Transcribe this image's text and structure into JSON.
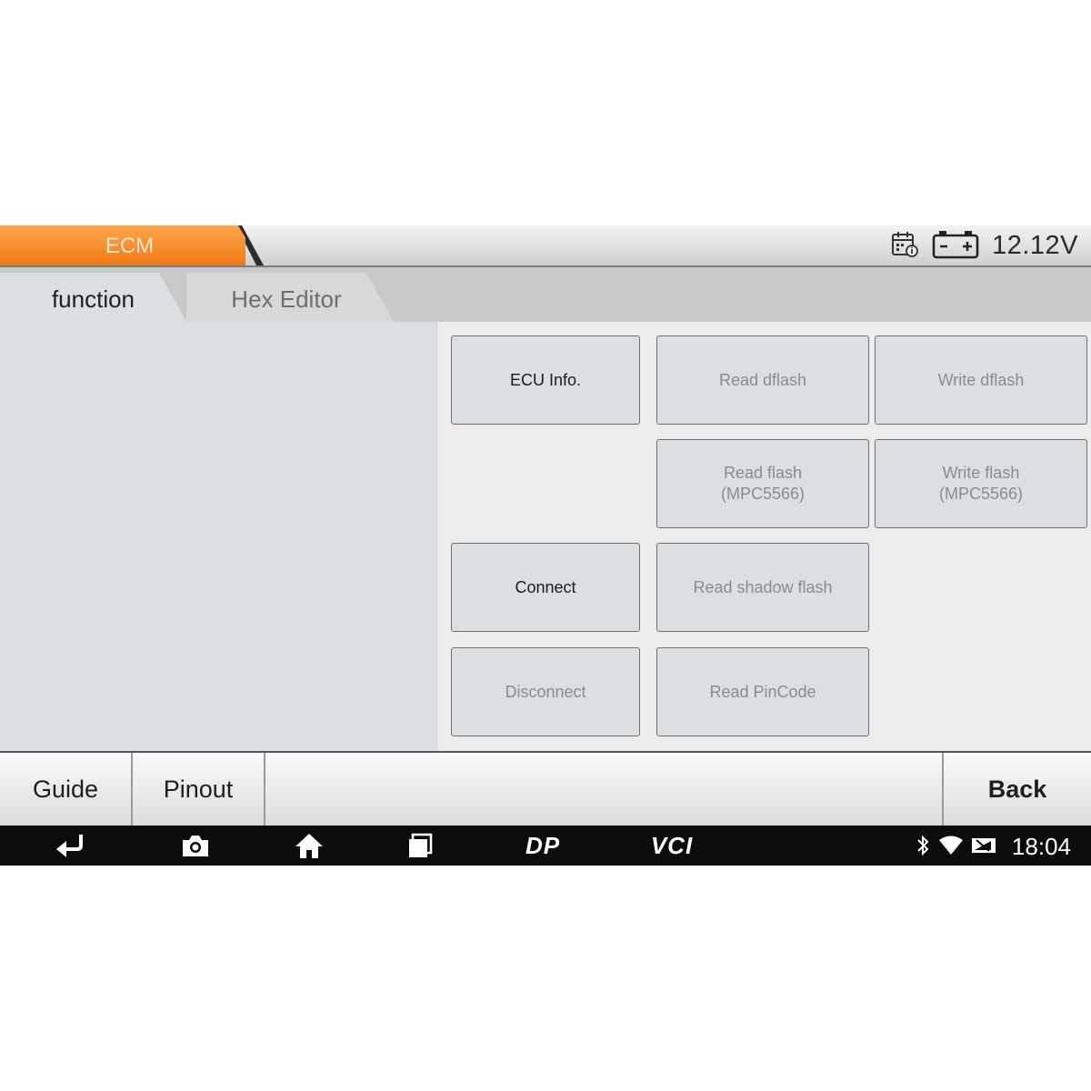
{
  "top_bar": {
    "module_title": "ECM",
    "voltage": "12.12V",
    "icons": [
      "calendar-info-icon",
      "battery-icon"
    ]
  },
  "tabs": [
    {
      "label": "function",
      "selected": true
    },
    {
      "label": "Hex Editor",
      "selected": false
    }
  ],
  "functions": {
    "ecu_info": {
      "label": "ECU Info.",
      "enabled": true
    },
    "read_dflash": {
      "label": "Read dflash",
      "enabled": false
    },
    "write_dflash": {
      "label": "Write dflash",
      "enabled": false
    },
    "read_flash": {
      "label": "Read flash\n(MPC5566)",
      "enabled": false
    },
    "write_flash": {
      "label": "Write flash\n(MPC5566)",
      "enabled": false
    },
    "connect": {
      "label": "Connect",
      "enabled": true
    },
    "read_shadow_flash": {
      "label": "Read shadow flash",
      "enabled": false
    },
    "disconnect": {
      "label": "Disconnect",
      "enabled": false
    },
    "read_pincode": {
      "label": "Read PinCode",
      "enabled": false
    }
  },
  "bottom_bar": {
    "guide": "Guide",
    "pinout": "Pinout",
    "back": "Back"
  },
  "nav_bar": {
    "dp_label": "DP",
    "vci_label": "VCI",
    "time": "18:04",
    "icons": [
      "back-icon",
      "camera-icon",
      "home-icon",
      "recents-icon",
      "bluetooth-icon",
      "wifi-icon",
      "signal-icon"
    ]
  },
  "colors": {
    "accent_orange": "#f5851f",
    "enabled_text": "#1a1a1a",
    "disabled_text": "#8a8a8a"
  }
}
